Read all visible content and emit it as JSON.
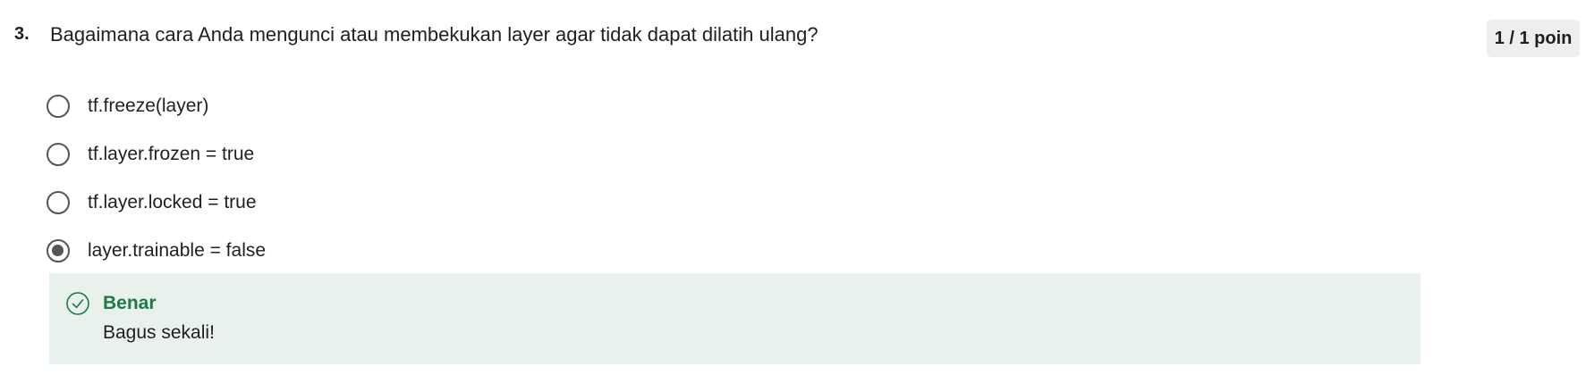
{
  "question": {
    "number": "3.",
    "text": "Bagaimana cara Anda mengunci atau membekukan layer agar tidak dapat dilatih ulang?",
    "score": "1 / 1 poin"
  },
  "options": [
    {
      "label": "tf.freeze(layer)",
      "selected": false
    },
    {
      "label": "tf.layer.frozen = true",
      "selected": false
    },
    {
      "label": "tf.layer.locked = true",
      "selected": false
    },
    {
      "label": "layer.trainable = false",
      "selected": true
    }
  ],
  "feedback": {
    "icon": "check-circle-icon",
    "title": "Benar",
    "message": "Bagus sekali!"
  },
  "colors": {
    "correct": "#1e7a47",
    "feedback_bg": "#e8f1ec",
    "badge_bg": "#eeeeee",
    "radio": "#555555"
  }
}
